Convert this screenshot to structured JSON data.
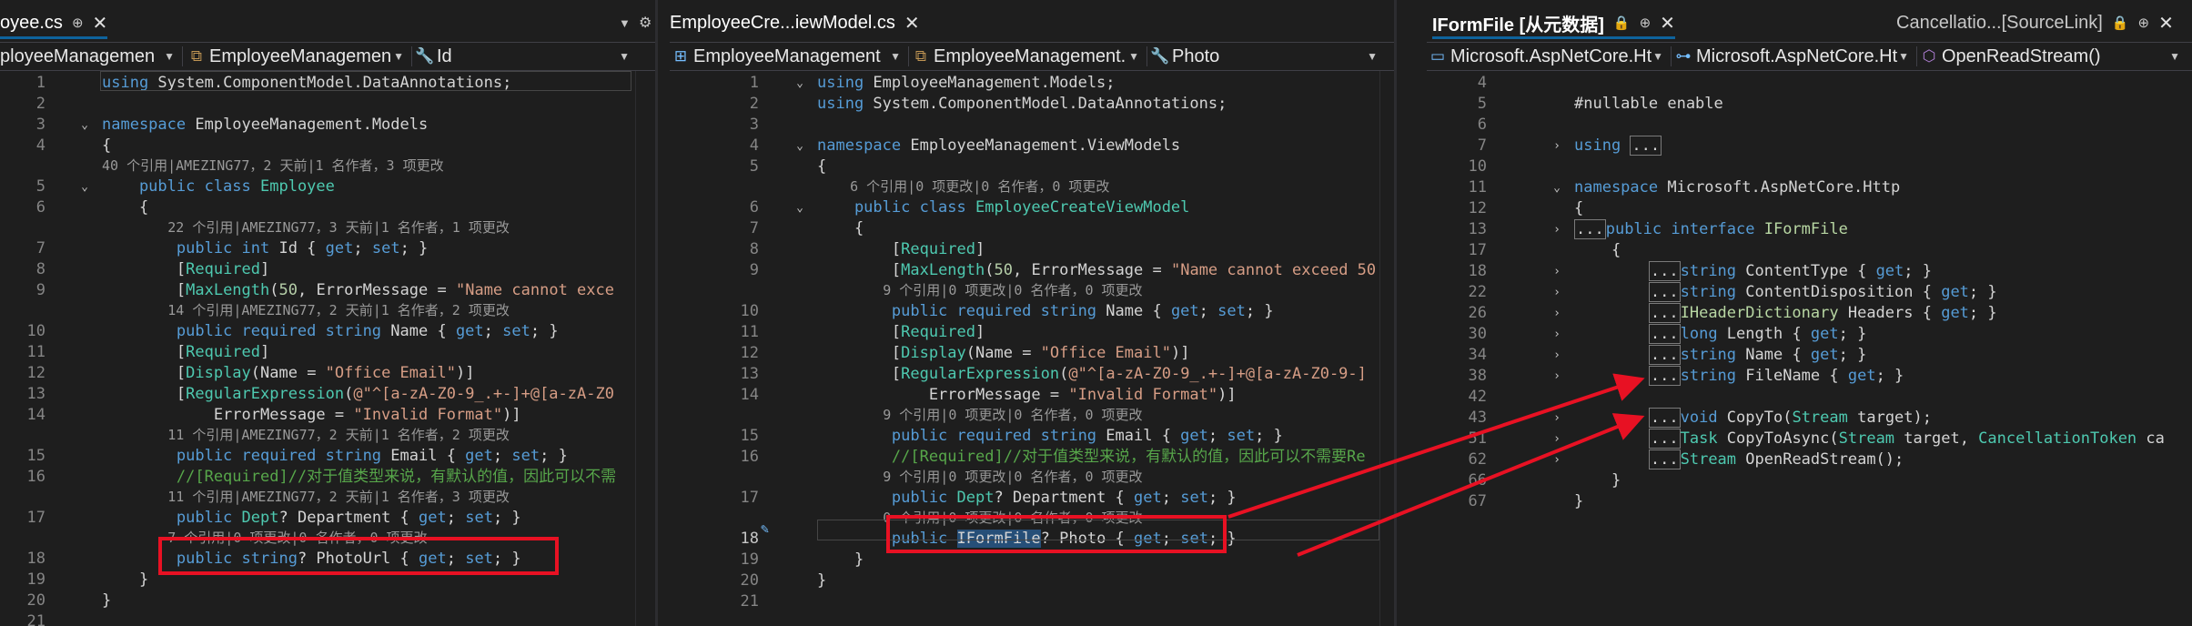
{
  "left": {
    "tab_label": "oyee.cs",
    "nav": [
      "ployeeManagemen",
      "EmployeeManagemen",
      "Id"
    ],
    "lines": [
      {
        "n": "1",
        "code": [
          [
            "k",
            "using "
          ],
          [
            "",
            "System.ComponentModel.DataAnnotations;"
          ]
        ]
      },
      {
        "n": "2",
        "code": []
      },
      {
        "n": "3",
        "code": [
          [
            "k",
            "namespace "
          ],
          [
            "",
            "EmployeeManagement.Models"
          ]
        ]
      },
      {
        "n": "4",
        "code": [
          [
            "",
            "{"
          ]
        ]
      },
      {
        "lens": "40 个引用|AMEZING77，2 天前|1 名作者，3 项更改"
      },
      {
        "n": "5",
        "code": [
          [
            "k",
            "    public class "
          ],
          [
            "t",
            "Employee"
          ]
        ]
      },
      {
        "n": "6",
        "code": [
          [
            "",
            "    {"
          ]
        ]
      },
      {
        "lens": "        22 个引用|AMEZING77，3 天前|1 名作者，1 项更改"
      },
      {
        "n": "7",
        "code": [
          [
            "k",
            "        public int "
          ],
          [
            "",
            "Id { "
          ],
          [
            "k",
            "get"
          ],
          [
            "",
            "; "
          ],
          [
            "k",
            "set"
          ],
          [
            "",
            "; }"
          ]
        ]
      },
      {
        "n": "8",
        "code": [
          [
            "",
            "        ["
          ],
          [
            "t",
            "Required"
          ],
          [
            "",
            "]"
          ]
        ]
      },
      {
        "n": "9",
        "code": [
          [
            "",
            "        ["
          ],
          [
            "t",
            "MaxLength"
          ],
          [
            "",
            "("
          ],
          [
            "n",
            "50"
          ],
          [
            "",
            ", ErrorMessage = "
          ],
          [
            "s",
            "\"Name cannot exce"
          ]
        ]
      },
      {
        "lens": "        14 个引用|AMEZING77，2 天前|1 名作者，2 项更改"
      },
      {
        "n": "10",
        "code": [
          [
            "k",
            "        public required string "
          ],
          [
            "",
            "Name { "
          ],
          [
            "k",
            "get"
          ],
          [
            "",
            "; "
          ],
          [
            "k",
            "set"
          ],
          [
            "",
            "; }"
          ]
        ]
      },
      {
        "n": "11",
        "code": [
          [
            "",
            "        ["
          ],
          [
            "t",
            "Required"
          ],
          [
            "",
            "]"
          ]
        ]
      },
      {
        "n": "12",
        "code": [
          [
            "",
            "        ["
          ],
          [
            "t",
            "Display"
          ],
          [
            "",
            "(Name = "
          ],
          [
            "s",
            "\"Office Email\""
          ],
          [
            "",
            ")]"
          ]
        ]
      },
      {
        "n": "13",
        "code": [
          [
            "",
            "        ["
          ],
          [
            "t",
            "RegularExpression"
          ],
          [
            "",
            "("
          ],
          [
            "s",
            "@\"^[a-zA-Z0-9_.+-]+@[a-zA-Z0"
          ]
        ]
      },
      {
        "n": "14",
        "code": [
          [
            "",
            "            ErrorMessage = "
          ],
          [
            "s",
            "\"Invalid Format\""
          ],
          [
            "",
            ")]"
          ]
        ]
      },
      {
        "lens": "        11 个引用|AMEZING77，2 天前|1 名作者，2 项更改"
      },
      {
        "n": "15",
        "code": [
          [
            "k",
            "        public required string "
          ],
          [
            "",
            "Email { "
          ],
          [
            "k",
            "get"
          ],
          [
            "",
            "; "
          ],
          [
            "k",
            "set"
          ],
          [
            "",
            "; }"
          ]
        ]
      },
      {
        "n": "16",
        "code": [
          [
            "c",
            "        //[Required]//对于值类型来说，有默认的值，因此可以不需"
          ]
        ]
      },
      {
        "lens": "        11 个引用|AMEZING77，2 天前|1 名作者，3 项更改"
      },
      {
        "n": "17",
        "code": [
          [
            "k",
            "        public "
          ],
          [
            "t",
            "Dept"
          ],
          [
            "",
            "? Department { "
          ],
          [
            "k",
            "get"
          ],
          [
            "",
            "; "
          ],
          [
            "k",
            "set"
          ],
          [
            "",
            "; }"
          ]
        ]
      },
      {
        "lens": "        7 个引用|0 项更改|0 名作者，0 项更改"
      },
      {
        "n": "18",
        "code": [
          [
            "k",
            "        public string"
          ],
          [
            "",
            "? PhotoUrl { "
          ],
          [
            "k",
            "get"
          ],
          [
            "",
            "; "
          ],
          [
            "k",
            "set"
          ],
          [
            "",
            "; }"
          ]
        ]
      },
      {
        "n": "19",
        "code": [
          [
            "",
            "    }"
          ]
        ]
      },
      {
        "n": "20",
        "code": [
          [
            "",
            "}"
          ]
        ]
      },
      {
        "n": "21",
        "code": []
      }
    ]
  },
  "middle": {
    "tab_label": "EmployeeCre...iewModel.cs",
    "nav": [
      "EmployeeManagement",
      "EmployeeManagement.",
      "Photo"
    ],
    "lines": [
      {
        "n": "1",
        "code": [
          [
            "k",
            "using "
          ],
          [
            "",
            "EmployeeManagement.Models;"
          ]
        ]
      },
      {
        "n": "2",
        "code": [
          [
            "k",
            "using "
          ],
          [
            "",
            "System.ComponentModel.DataAnnotations;"
          ]
        ]
      },
      {
        "n": "3",
        "code": []
      },
      {
        "n": "4",
        "code": [
          [
            "k",
            "namespace "
          ],
          [
            "",
            "EmployeeManagement.ViewModels"
          ]
        ]
      },
      {
        "n": "5",
        "code": [
          [
            "",
            "{"
          ]
        ]
      },
      {
        "lens": "    6 个引用|0 项更改|0 名作者，0 项更改"
      },
      {
        "n": "6",
        "code": [
          [
            "k",
            "    public class "
          ],
          [
            "t",
            "EmployeeCreateViewModel"
          ]
        ]
      },
      {
        "n": "7",
        "code": [
          [
            "",
            "    {"
          ]
        ]
      },
      {
        "n": "8",
        "code": [
          [
            "",
            "        ["
          ],
          [
            "t",
            "Required"
          ],
          [
            "",
            "]"
          ]
        ]
      },
      {
        "n": "9",
        "code": [
          [
            "",
            "        ["
          ],
          [
            "t",
            "MaxLength"
          ],
          [
            "",
            "("
          ],
          [
            "n",
            "50"
          ],
          [
            "",
            ", ErrorMessage = "
          ],
          [
            "s",
            "\"Name cannot exceed 50"
          ]
        ]
      },
      {
        "lens": "        9 个引用|0 项更改|0 名作者，0 项更改"
      },
      {
        "n": "10",
        "code": [
          [
            "k",
            "        public required string "
          ],
          [
            "",
            "Name { "
          ],
          [
            "k",
            "get"
          ],
          [
            "",
            "; "
          ],
          [
            "k",
            "set"
          ],
          [
            "",
            "; }"
          ]
        ]
      },
      {
        "n": "11",
        "code": [
          [
            "",
            "        ["
          ],
          [
            "t",
            "Required"
          ],
          [
            "",
            "]"
          ]
        ]
      },
      {
        "n": "12",
        "code": [
          [
            "",
            "        ["
          ],
          [
            "t",
            "Display"
          ],
          [
            "",
            "(Name = "
          ],
          [
            "s",
            "\"Office Email\""
          ],
          [
            "",
            ")]"
          ]
        ]
      },
      {
        "n": "13",
        "code": [
          [
            "",
            "        ["
          ],
          [
            "t",
            "RegularExpression"
          ],
          [
            "",
            "("
          ],
          [
            "s",
            "@\"^[a-zA-Z0-9_.+-]+@[a-zA-Z0-9-]"
          ]
        ]
      },
      {
        "n": "14",
        "code": [
          [
            "",
            "            ErrorMessage = "
          ],
          [
            "s",
            "\"Invalid Format\""
          ],
          [
            "",
            ")]"
          ]
        ]
      },
      {
        "lens": "        9 个引用|0 项更改|0 名作者，0 项更改"
      },
      {
        "n": "15",
        "code": [
          [
            "k",
            "        public required string "
          ],
          [
            "",
            "Email { "
          ],
          [
            "k",
            "get"
          ],
          [
            "",
            "; "
          ],
          [
            "k",
            "set"
          ],
          [
            "",
            "; }"
          ]
        ]
      },
      {
        "n": "16",
        "code": [
          [
            "c",
            "        //[Required]//对于值类型来说，有默认的值，因此可以不需要Re"
          ]
        ]
      },
      {
        "lens": "        9 个引用|0 项更改|0 名作者，0 项更改"
      },
      {
        "n": "17",
        "code": [
          [
            "k",
            "        public "
          ],
          [
            "t",
            "Dept"
          ],
          [
            "",
            "? Department { "
          ],
          [
            "k",
            "get"
          ],
          [
            "",
            "; "
          ],
          [
            "k",
            "set"
          ],
          [
            "",
            "; }"
          ]
        ]
      },
      {
        "lens": "        0 个引用|0 项更改|0 名作者，0 项更改"
      },
      {
        "n": "18",
        "code": [
          [
            "k",
            "        public "
          ],
          [
            "hl",
            "IFormFile"
          ],
          [
            "",
            "? Photo { "
          ],
          [
            "k",
            "get"
          ],
          [
            "",
            "; "
          ],
          [
            "k",
            "set"
          ],
          [
            "",
            "; }"
          ]
        ]
      },
      {
        "n": "19",
        "code": [
          [
            "",
            "    }"
          ]
        ]
      },
      {
        "n": "20",
        "code": [
          [
            "",
            "}"
          ]
        ]
      },
      {
        "n": "21",
        "code": []
      }
    ]
  },
  "right": {
    "tab_label": "IFormFile [从元数据]",
    "tab2_label": "Cancellatio...[SourceLink]",
    "nav": [
      "Microsoft.AspNetCore.Ht",
      "Microsoft.AspNetCore.Ht",
      "OpenReadStream()"
    ],
    "lines": [
      {
        "n": "4",
        "code": []
      },
      {
        "n": "5",
        "code": [
          [
            "",
            "#nullable enable"
          ]
        ]
      },
      {
        "n": "6",
        "code": []
      },
      {
        "n": "7",
        "code": [
          [
            "k",
            "using "
          ],
          [
            "box",
            "..."
          ]
        ]
      },
      {
        "n": "10",
        "code": []
      },
      {
        "n": "11",
        "code": [
          [
            "k",
            "namespace "
          ],
          [
            "",
            "Microsoft.AspNetCore.Http"
          ]
        ]
      },
      {
        "n": "12",
        "code": [
          [
            "",
            "{"
          ]
        ]
      },
      {
        "n": "13",
        "code": [
          [
            "box",
            "..."
          ],
          [
            "k",
            "public interface "
          ],
          [
            "tp",
            "IFormFile"
          ]
        ]
      },
      {
        "n": "17",
        "code": [
          [
            "",
            "    {"
          ]
        ]
      },
      {
        "n": "18",
        "code": [
          [
            "",
            "        "
          ],
          [
            "box",
            "..."
          ],
          [
            "k",
            "string "
          ],
          [
            "",
            "ContentType { "
          ],
          [
            "k",
            "get"
          ],
          [
            "",
            "; }"
          ]
        ]
      },
      {
        "n": "22",
        "code": [
          [
            "",
            "        "
          ],
          [
            "box",
            "..."
          ],
          [
            "k",
            "string "
          ],
          [
            "",
            "ContentDisposition { "
          ],
          [
            "k",
            "get"
          ],
          [
            "",
            "; }"
          ]
        ]
      },
      {
        "n": "26",
        "code": [
          [
            "",
            "        "
          ],
          [
            "box",
            "..."
          ],
          [
            "tp",
            "IHeaderDictionary "
          ],
          [
            "",
            "Headers { "
          ],
          [
            "k",
            "get"
          ],
          [
            "",
            "; }"
          ]
        ]
      },
      {
        "n": "30",
        "code": [
          [
            "",
            "        "
          ],
          [
            "box",
            "..."
          ],
          [
            "k",
            "long "
          ],
          [
            "",
            "Length { "
          ],
          [
            "k",
            "get"
          ],
          [
            "",
            "; }"
          ]
        ]
      },
      {
        "n": "34",
        "code": [
          [
            "",
            "        "
          ],
          [
            "box",
            "..."
          ],
          [
            "k",
            "string "
          ],
          [
            "",
            "Name { "
          ],
          [
            "k",
            "get"
          ],
          [
            "",
            "; }"
          ]
        ]
      },
      {
        "n": "38",
        "code": [
          [
            "",
            "        "
          ],
          [
            "box",
            "..."
          ],
          [
            "k",
            "string "
          ],
          [
            "",
            "FileName { "
          ],
          [
            "k",
            "get"
          ],
          [
            "",
            "; }"
          ]
        ]
      },
      {
        "n": "42",
        "code": []
      },
      {
        "n": "43",
        "code": [
          [
            "",
            "        "
          ],
          [
            "box",
            "..."
          ],
          [
            "k",
            "void "
          ],
          [
            "",
            "CopyTo("
          ],
          [
            "t",
            "Stream "
          ],
          [
            "",
            "target);"
          ]
        ]
      },
      {
        "n": "51",
        "code": [
          [
            "",
            "        "
          ],
          [
            "box",
            "..."
          ],
          [
            "t",
            "Task "
          ],
          [
            "",
            "CopyToAsync("
          ],
          [
            "t",
            "Stream "
          ],
          [
            "",
            "target, "
          ],
          [
            "t",
            "CancellationToken "
          ],
          [
            "",
            "ca"
          ]
        ]
      },
      {
        "n": "62",
        "code": [
          [
            "",
            "        "
          ],
          [
            "box",
            "..."
          ],
          [
            "t",
            "Stream "
          ],
          [
            "",
            "OpenReadStream();"
          ]
        ]
      },
      {
        "n": "66",
        "code": [
          [
            "",
            "    }"
          ]
        ]
      },
      {
        "n": "67",
        "code": [
          [
            "",
            "}"
          ]
        ]
      }
    ]
  }
}
